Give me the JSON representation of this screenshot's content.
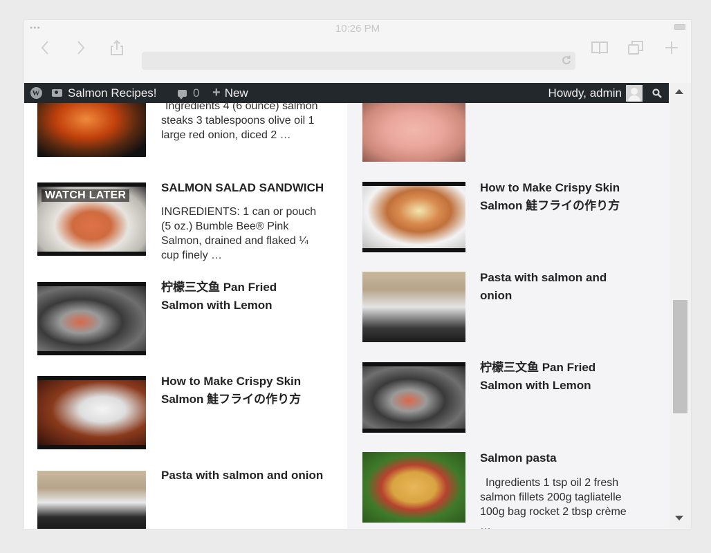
{
  "status_bar": {
    "time": "10:26 PM"
  },
  "admin_bar": {
    "site_name": "Salmon Recipes!",
    "comments_count": "0",
    "new_label": "New",
    "howdy": "Howdy, admin"
  },
  "left_column": [
    {
      "title": "",
      "excerpt": "Ingredients 4 (6 ounce) salmon steaks 3 tablespoons olive oil 1 large red onion, diced 2 …",
      "thumb_colors": [
        "#c2410c",
        "#111111"
      ]
    },
    {
      "title": "SALMON SALAD SANDWICH",
      "excerpt": "INGREDIENTS: 1 can or pouch (5 oz.) Bumble Bee® Pink Salmon, drained and flaked ¼ cup finely …",
      "overlay": "WATCH LATER",
      "thumb_colors": [
        "#e8e6e0",
        "#d97748"
      ]
    },
    {
      "title": "柠檬三文鱼 Pan Fried Salmon with Lemon",
      "excerpt": "",
      "thumb_colors": [
        "#3a3a3a",
        "#8c8c8c"
      ]
    },
    {
      "title": "How to Make Crispy Skin Salmon 鮭フライの作り方",
      "excerpt": "",
      "thumb_colors": [
        "#7a2e16",
        "#efefef"
      ]
    },
    {
      "title": "Pasta with salmon and onion",
      "excerpt": "",
      "thumb_colors": [
        "#b7a48a",
        "#2b2b2b"
      ]
    }
  ],
  "right_column": [
    {
      "title": "",
      "excerpt": "",
      "thumb_colors": [
        "#e9a59b",
        "#cf8a7c"
      ]
    },
    {
      "title": "How to Make Crispy Skin Salmon 鮭フライの作り方",
      "excerpt": "",
      "thumb_colors": [
        "#f1f1f1",
        "#c0713b"
      ]
    },
    {
      "title": "Pasta with salmon and onion",
      "excerpt": "",
      "thumb_colors": [
        "#b7a48a",
        "#2b2b2b"
      ]
    },
    {
      "title": "柠檬三文鱼 Pan Fried Salmon with Lemon",
      "excerpt": "",
      "thumb_colors": [
        "#3a3a3a",
        "#8c8c8c"
      ]
    },
    {
      "title": "Salmon pasta",
      "excerpt": "Ingredients 1 tsp oil 2 fresh salmon fillets 200g tagliatelle 100g bag rocket 2 tbsp crème …",
      "thumb_colors": [
        "#d9a441",
        "#3f7a2a"
      ]
    }
  ],
  "icons": {
    "back": "chevron-left-icon",
    "forward": "chevron-right-icon",
    "share": "share-icon",
    "bookmarks": "book-icon",
    "tabs": "tabs-icon",
    "new_tab": "plus-icon",
    "reload": "reload-icon",
    "search": "search-icon"
  },
  "colors": {
    "admin_bar_bg": "#23282d",
    "page_bg": "#ffffff",
    "right_col_bg": "#f4f4f6"
  }
}
